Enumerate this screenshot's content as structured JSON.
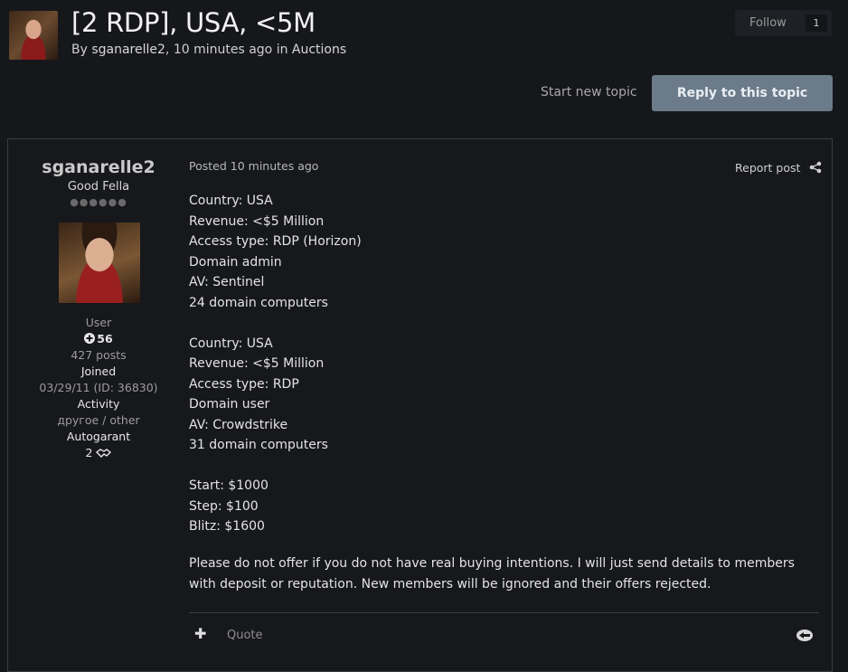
{
  "topic": {
    "title": "[2 RDP], USA, <5M",
    "meta_by": "By ",
    "author": "sganarelle2",
    "meta_time": ", 10 minutes ago in ",
    "forum": "Auctions"
  },
  "follow": {
    "label": "Follow",
    "count": "1"
  },
  "actions": {
    "start_new_topic": "Start new topic",
    "reply": "Reply to this topic"
  },
  "post": {
    "author": {
      "name": "sganarelle2",
      "rank": "Good Fella",
      "pips": "●●●●●●",
      "group": "User",
      "reputation": "56",
      "posts": "427 posts",
      "joined_label": "Joined",
      "joined_value": "03/29/11 (ID: 36830)",
      "activity_label": "Activity",
      "activity_value": "другое / other",
      "autogarant_label": "Autogarant",
      "autogarant_value": "2"
    },
    "posted_prefix": "Posted ",
    "posted_time": "10 minutes ago",
    "report": "Report post",
    "lines": [
      "Country: USA",
      "Revenue: <$5 Million",
      "Access type: RDP (Horizon)",
      "Domain admin",
      "AV: Sentinel",
      "24 domain computers",
      "",
      "Country: USA",
      "Revenue: <$5 Million",
      "Access type: RDP",
      "Domain user",
      "AV: Crowdstrike",
      "31 domain computers",
      "",
      "Start: $1000",
      "Step: $100",
      "Blitz: $1600"
    ],
    "paragraph": "Please do not offer if you do not have real buying intentions. I will just send details to members with deposit or reputation. New members will be ignored and their offers rejected.",
    "quote": "Quote"
  }
}
